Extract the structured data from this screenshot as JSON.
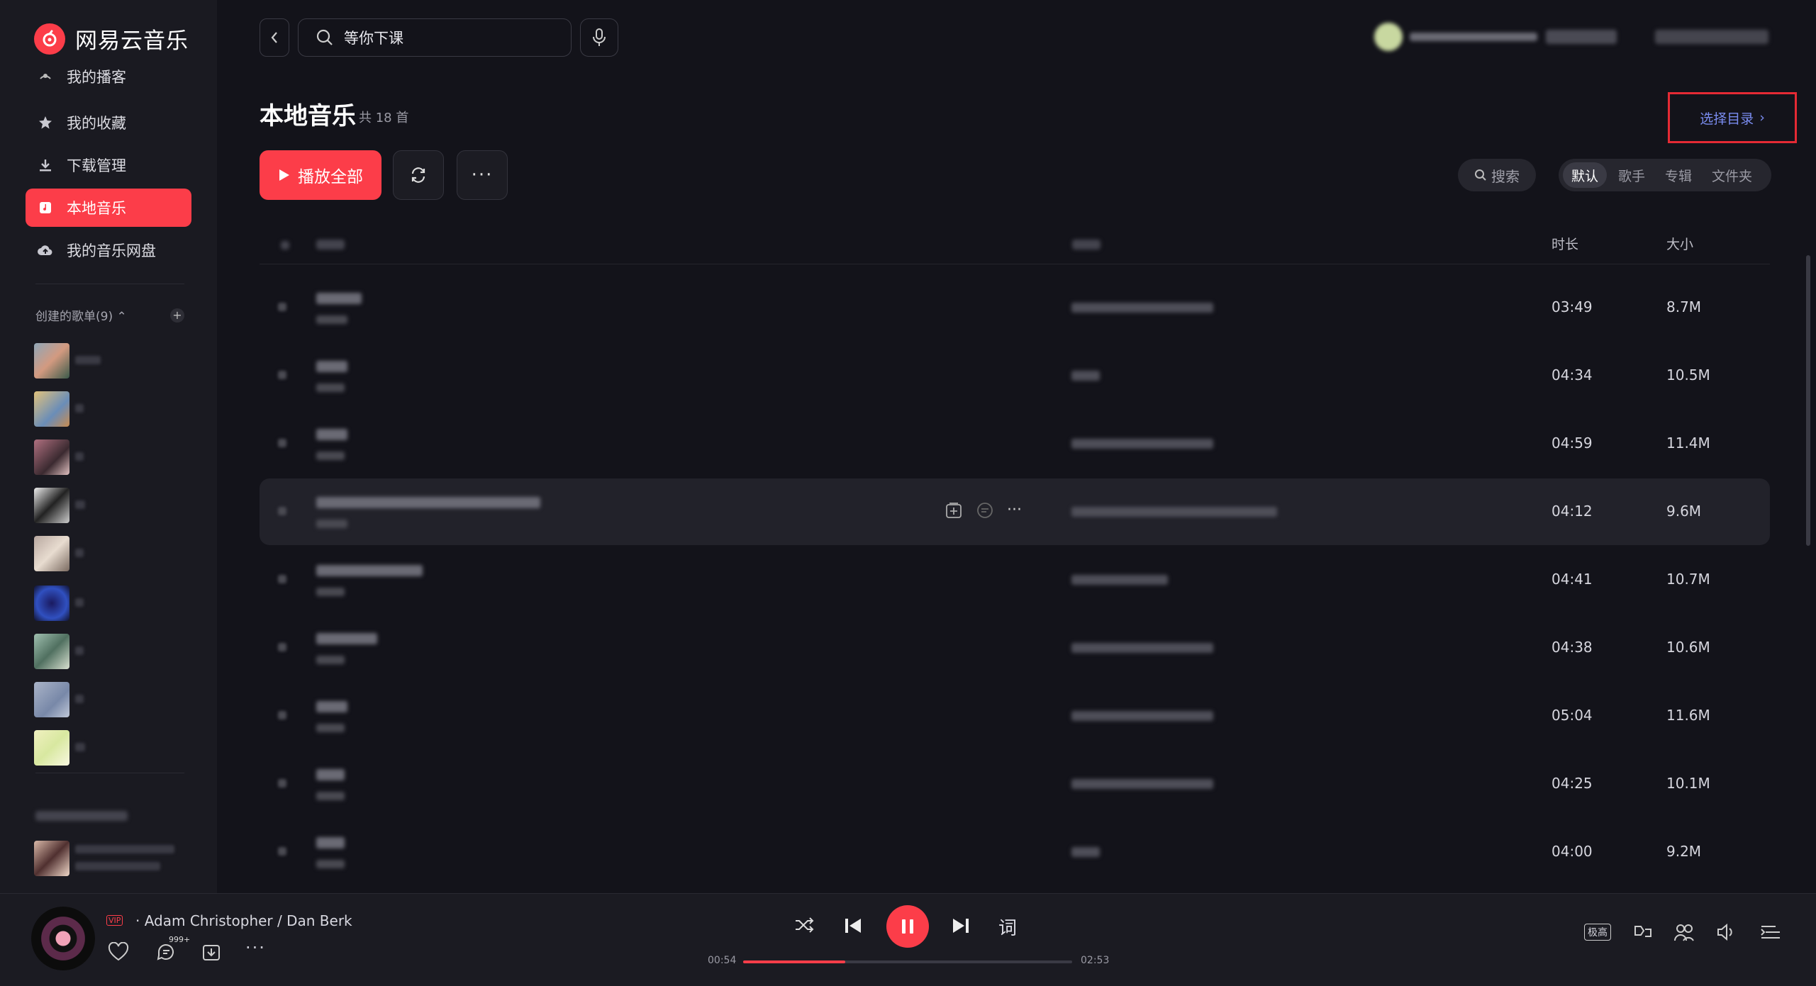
{
  "app": {
    "name": "网易云音乐"
  },
  "sidebar": {
    "items": [
      {
        "label": "我的播客",
        "icon": "podcast-icon"
      },
      {
        "label": "我的收藏",
        "icon": "star-icon"
      },
      {
        "label": "下载管理",
        "icon": "download-icon"
      },
      {
        "label": "本地音乐",
        "icon": "local-music-icon",
        "active": true
      },
      {
        "label": "我的音乐网盘",
        "icon": "cloud-icon"
      }
    ],
    "created_playlists_label": "创建的歌单(9)"
  },
  "topbar": {
    "search_value": "等你下课"
  },
  "main": {
    "title": "本地音乐",
    "count": "共 18 首",
    "choose_dir": "选择目录",
    "play_all": "播放全部",
    "search_label": "搜索",
    "sort_tabs": [
      "默认",
      "歌手",
      "专辑",
      "文件夹"
    ],
    "columns": {
      "duration": "时长",
      "size": "大小"
    },
    "rows": [
      {
        "duration": "03:49",
        "size": "8.7M"
      },
      {
        "duration": "04:34",
        "size": "10.5M"
      },
      {
        "duration": "04:59",
        "size": "11.4M"
      },
      {
        "duration": "04:12",
        "size": "9.6M"
      },
      {
        "duration": "04:41",
        "size": "10.7M"
      },
      {
        "duration": "04:38",
        "size": "10.6M"
      },
      {
        "duration": "05:04",
        "size": "11.6M"
      },
      {
        "duration": "04:25",
        "size": "10.1M"
      },
      {
        "duration": "04:00",
        "size": "9.2M"
      }
    ]
  },
  "player": {
    "vip": "VIP",
    "artist": "· Adam Christopher / Dan Berk",
    "comment_count": "999+",
    "lyrics_label": "词",
    "current_time": "00:54",
    "total_time": "02:53",
    "progress": 0.31,
    "quality": "极高"
  },
  "colors": {
    "accent": "#fc3d49",
    "bg": "#13131a",
    "sidebar": "#1a1a21"
  }
}
